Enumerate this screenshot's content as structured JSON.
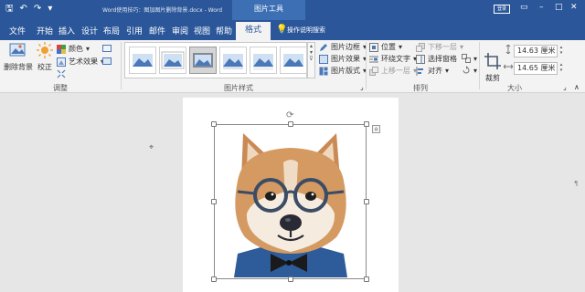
{
  "title_bar": {
    "doc_title": "Word使用技巧：图加图片删除背景.docx - Word",
    "contextual_label": "图片工具",
    "login": "登录",
    "bg": "#2b579a",
    "contextual_bg": "#3c6fb4"
  },
  "tabs": [
    {
      "label": "文件"
    },
    {
      "label": "开始"
    },
    {
      "label": "插入"
    },
    {
      "label": "设计"
    },
    {
      "label": "布局"
    },
    {
      "label": "引用"
    },
    {
      "label": "邮件"
    },
    {
      "label": "审阅"
    },
    {
      "label": "视图"
    },
    {
      "label": "帮助"
    }
  ],
  "active_tab": "格式",
  "tell_me": "操作说明搜索",
  "ribbon": {
    "adjust": {
      "remove_bg": "删除背景",
      "correct": "校正",
      "color": "颜色",
      "artistic": "艺术效果",
      "label": "调整"
    },
    "styles": {
      "border": "图片边框",
      "effects": "图片效果",
      "layout": "图片版式",
      "label": "图片样式"
    },
    "arrange": {
      "position": "位置",
      "wrap": "环绕文字",
      "forward": "上移一层",
      "backward": "下移一层",
      "pane": "选择窗格",
      "align": "对齐",
      "label": "排列"
    },
    "size": {
      "crop": "裁剪",
      "height": "14.63 厘米",
      "width": "14.65 厘米",
      "label": "大小"
    }
  }
}
